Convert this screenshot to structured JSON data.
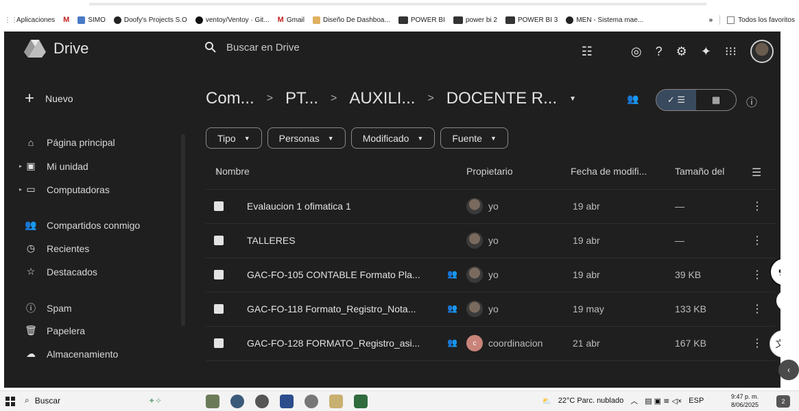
{
  "bookmarks": {
    "items": [
      {
        "label": "Aplicaciones",
        "icon": "apps-grid-icon",
        "color": "#555555"
      },
      {
        "label": "",
        "icon": "gmail-icon",
        "color": "#c5221f"
      },
      {
        "label": "SIMO",
        "icon": "simo-icon",
        "color": "#4a7ac7"
      },
      {
        "label": "Doofy's Projects S.O",
        "icon": "doofy-icon",
        "color": "#222222"
      },
      {
        "label": "ventoy/Ventoy · Git...",
        "icon": "github-icon",
        "color": "#111111"
      },
      {
        "label": "Gmail",
        "icon": "gmail-icon",
        "color": "#c5221f"
      },
      {
        "label": "Diseño De Dashboa...",
        "icon": "page-icon",
        "color": "#e0b060"
      },
      {
        "label": "POWER BI",
        "icon": "powerbi-icon",
        "color": "#333333"
      },
      {
        "label": "power bi 2",
        "icon": "powerbi-icon",
        "color": "#333333"
      },
      {
        "label": "POWER BI 3",
        "icon": "powerbi-icon",
        "color": "#333333"
      },
      {
        "label": "MEN - Sistema mae...",
        "icon": "globe-icon",
        "color": "#222222"
      }
    ],
    "overflow": "»",
    "all_favorites": "Todos los favoritos"
  },
  "header": {
    "app_name": "Drive",
    "search_placeholder": "Buscar en Drive"
  },
  "sidebar": {
    "new_label": "Nuevo",
    "items": [
      {
        "label": "Página principal",
        "icon": "home-icon"
      },
      {
        "label": "Mi unidad",
        "icon": "drive-icon"
      },
      {
        "label": "Computadoras",
        "icon": "computer-icon"
      },
      {
        "label": "Compartidos conmigo",
        "icon": "people-icon"
      },
      {
        "label": "Recientes",
        "icon": "clock-icon"
      },
      {
        "label": "Destacados",
        "icon": "star-icon"
      },
      {
        "label": "Spam",
        "icon": "spam-icon"
      },
      {
        "label": "Papelera",
        "icon": "trash-icon"
      },
      {
        "label": "Almacenamiento",
        "icon": "cloud-icon"
      }
    ]
  },
  "breadcrumb": {
    "items": [
      "Com...",
      "PT...",
      "AUXILI...",
      "DOCENTE R..."
    ]
  },
  "filters": [
    "Tipo",
    "Personas",
    "Modificado",
    "Fuente"
  ],
  "table": {
    "columns": {
      "name": "Nombre",
      "owner": "Propietario",
      "modified": "Fecha de modifi...",
      "size": "Tamaño del"
    },
    "rows": [
      {
        "name": "Evalaucion 1 ofimatica 1",
        "type": "shared-folder",
        "color": "#e3e3e3",
        "shared": false,
        "owner": "yo",
        "avatar": "photo",
        "modified": "19 abr",
        "size": "—"
      },
      {
        "name": "TALLERES",
        "type": "shared-folder",
        "color": "#e3e3e3",
        "shared": false,
        "owner": "yo",
        "avatar": "photo",
        "modified": "19 abr",
        "size": "—"
      },
      {
        "name": "GAC-FO-105 CONTABLE Formato Pla...",
        "type": "sheet",
        "color": "#e3e3e3",
        "shared": true,
        "owner": "yo",
        "avatar": "photo",
        "modified": "19 abr",
        "size": "39 KB"
      },
      {
        "name": "GAC-FO-118 Formato_Registro_Nota...",
        "type": "sheet",
        "color": "#e3e3e3",
        "shared": true,
        "owner": "yo",
        "avatar": "photo",
        "modified": "19 may",
        "size": "133 KB"
      },
      {
        "name": "GAC-FO-128 FORMATO_Registro_asi...",
        "type": "excel",
        "color": "#e3e3e3",
        "shared": true,
        "owner": "coordinacion",
        "avatar": "c",
        "modified": "21 abr",
        "size": "167 KB"
      }
    ]
  },
  "taskbar": {
    "search_label": "Buscar",
    "weather": "22°C  Parc. nublado",
    "lang": "ESP",
    "time": "9:47 p. m.",
    "date": "8/06/2025",
    "notifications": "2"
  }
}
